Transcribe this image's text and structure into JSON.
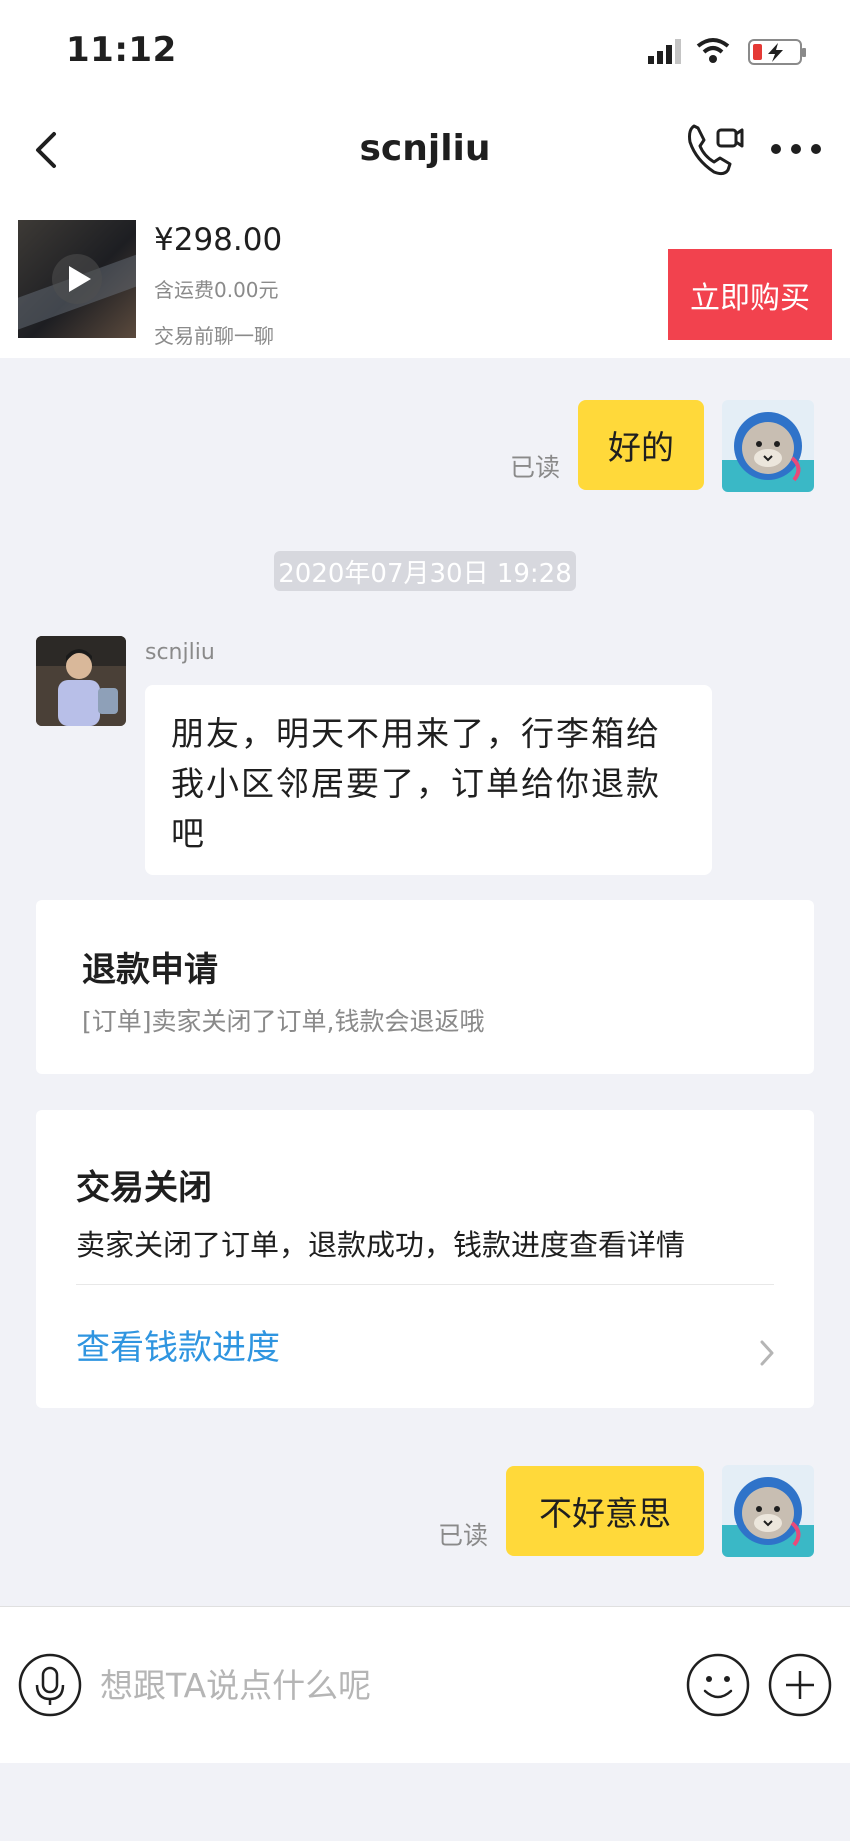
{
  "status_bar": {
    "time": "11:12"
  },
  "nav": {
    "title": "scnjliu"
  },
  "product": {
    "price": "¥298.00",
    "shipping": "含运费0.00元",
    "note": "交易前聊一聊",
    "buy_label": "立即购买"
  },
  "messages": {
    "first": {
      "text": "好的",
      "read": "已读"
    },
    "timestamp": "2020年07月30日 19:28",
    "incoming": {
      "sender": "scnjliu",
      "text": "朋友，明天不用来了，行李箱给我小区邻居要了，订单给你退款吧"
    },
    "refund_card": {
      "title": "退款申请",
      "subtitle": "[订单]卖家关闭了订单,钱款会退返哦"
    },
    "closed_card": {
      "title": "交易关闭",
      "body": "卖家关闭了订单，退款成功，钱款进度查看详情",
      "link": "查看钱款进度"
    },
    "last": {
      "text": "不好意思",
      "read": "已读"
    }
  },
  "input": {
    "placeholder": "想跟TA说点什么呢"
  },
  "colors": {
    "accent_yellow": "#ffd93a",
    "buy_red": "#f2424e",
    "link_blue": "#2f95e0"
  }
}
